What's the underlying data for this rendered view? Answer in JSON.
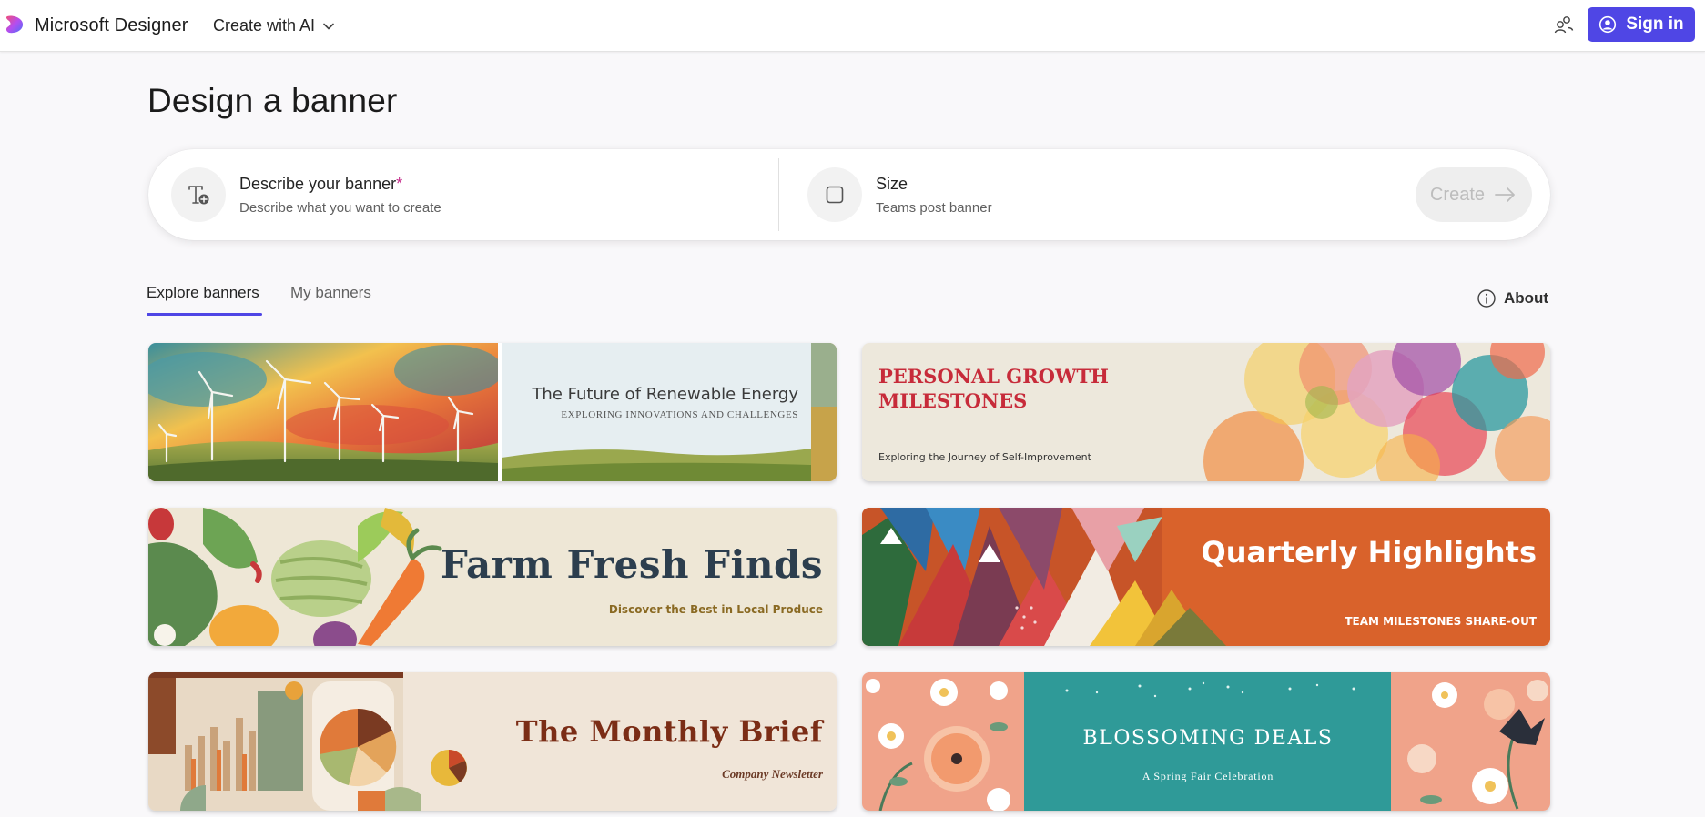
{
  "header": {
    "brand": "Microsoft Designer",
    "menu_label": "Create with AI",
    "sign_in_label": "Sign in",
    "accent_color": "#4f46e5"
  },
  "page": {
    "title": "Design a banner"
  },
  "prompt": {
    "describe_label": "Describe your banner",
    "required_mark": "*",
    "describe_placeholder": "Describe what you want to create",
    "size_label": "Size",
    "size_value": "Teams post banner",
    "create_label": "Create"
  },
  "tabs": {
    "explore": "Explore banners",
    "mine": "My banners",
    "about": "About"
  },
  "cards": [
    {
      "title": "The Future of Renewable Energy",
      "subtitle": "EXPLORING INNOVATIONS AND CHALLENGES"
    },
    {
      "title": "PERSONAL GROWTH MILESTONES",
      "subtitle": "Exploring the Journey of Self-Improvement"
    },
    {
      "title": "Farm Fresh Finds",
      "subtitle": "Discover the Best in Local Produce"
    },
    {
      "title": "Quarterly Highlights",
      "subtitle": "TEAM MILESTONES SHARE-OUT"
    },
    {
      "title": "The Monthly Brief",
      "subtitle": "Company Newsletter"
    },
    {
      "title": "BLOSSOMING DEALS",
      "subtitle": "A Spring Fair Celebration"
    }
  ]
}
